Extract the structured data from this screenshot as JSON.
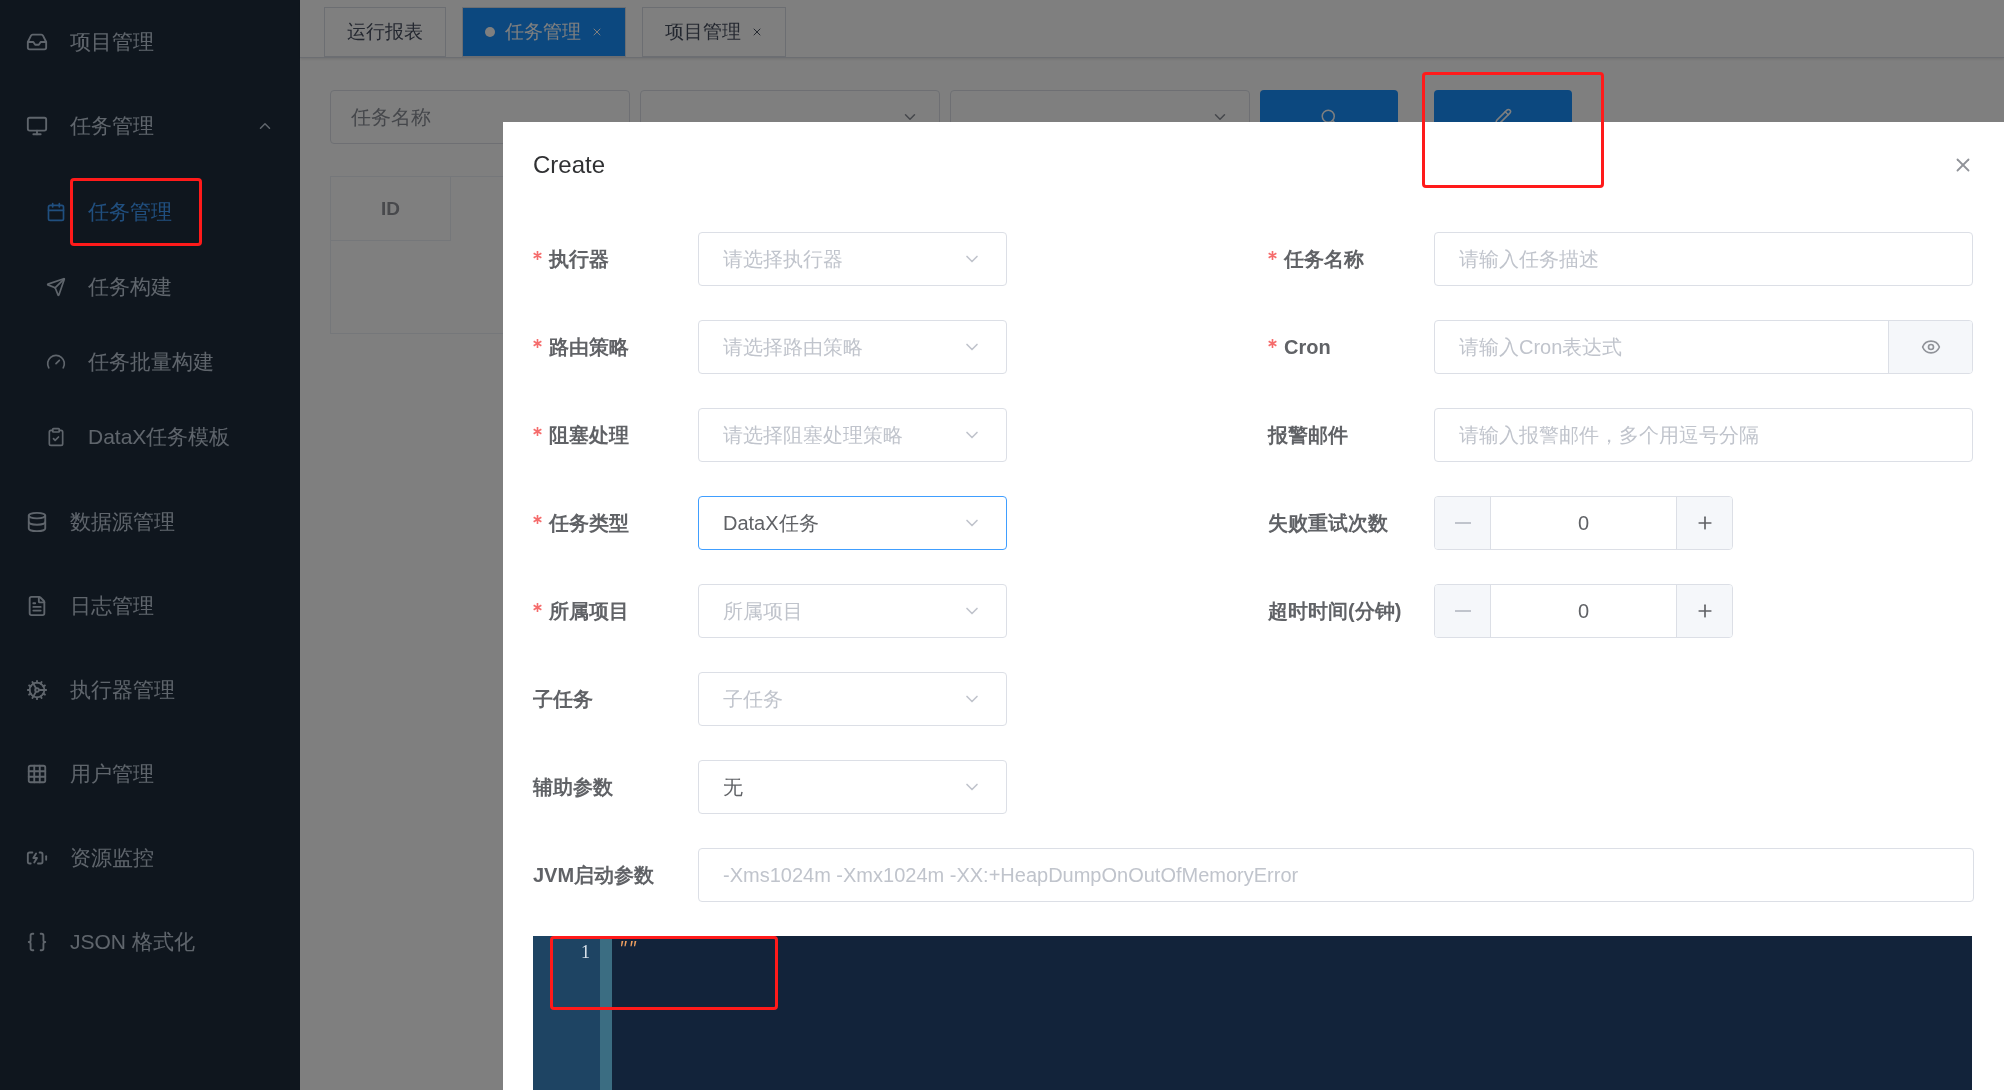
{
  "sidebar": {
    "items": [
      {
        "label": "项目管理"
      },
      {
        "label": "任务管理",
        "expanded": true,
        "children": [
          {
            "label": "任务管理",
            "selected": true,
            "highlighted": true
          },
          {
            "label": "任务构建",
            "selected": false,
            "highlighted": false
          },
          {
            "label": "任务批量构建",
            "selected": false,
            "highlighted": false
          },
          {
            "label": "DataX任务模板",
            "selected": false,
            "highlighted": false
          }
        ]
      },
      {
        "label": "数据源管理"
      },
      {
        "label": "日志管理"
      },
      {
        "label": "执行器管理"
      },
      {
        "label": "用户管理"
      },
      {
        "label": "资源监控"
      },
      {
        "label": "JSON 格式化"
      }
    ]
  },
  "tabs": [
    {
      "label": "运行报表",
      "selected": false,
      "closable": false
    },
    {
      "label": "任务管理",
      "selected": true,
      "closable": true
    },
    {
      "label": "项目管理",
      "selected": false,
      "closable": true
    }
  ],
  "toolbar": {
    "filters": [
      {
        "kind": "input",
        "placeholder": "任务名称"
      },
      {
        "kind": "select"
      },
      {
        "kind": "select"
      }
    ],
    "buttons": [
      {
        "kind": "search",
        "highlighted": false
      },
      {
        "kind": "add",
        "highlighted": true
      }
    ]
  },
  "table": {
    "columns": [
      "ID"
    ]
  },
  "modal": {
    "title": "Create",
    "left_fields": [
      {
        "label": "执行器",
        "required": true,
        "placeholder": "请选择执行器",
        "focused": false
      },
      {
        "label": "路由策略",
        "required": true,
        "placeholder": "请选择路由策略",
        "focused": false
      },
      {
        "label": "阻塞处理",
        "required": true,
        "placeholder": "请选择阻塞处理策略",
        "focused": false
      },
      {
        "label": "任务类型",
        "required": true,
        "value": "DataX任务",
        "focused": true
      },
      {
        "label": "所属项目",
        "required": true,
        "placeholder": "所属项目",
        "focused": false
      },
      {
        "label": "子任务",
        "required": false,
        "placeholder": "子任务",
        "focused": false
      },
      {
        "label": "辅助参数",
        "required": false,
        "value": "无",
        "focused": false
      }
    ],
    "right_fields": [
      {
        "kind": "input",
        "label": "任务名称",
        "required": true,
        "placeholder": "请输入任务描述"
      },
      {
        "kind": "cron",
        "label": "Cron",
        "required": true,
        "placeholder": "请输入Cron表达式"
      },
      {
        "kind": "input",
        "label": "报警邮件",
        "required": false,
        "placeholder": "请输入报警邮件，多个用逗号分隔"
      },
      {
        "kind": "number",
        "label": "失败重试次数",
        "required": false,
        "value": "0"
      },
      {
        "kind": "number",
        "label": "超时时间(分钟)",
        "required": false,
        "value": "0"
      }
    ],
    "jvm": {
      "label": "JVM启动参数",
      "placeholder": "-Xms1024m -Xmx1024m -XX:+HeapDumpOnOutOfMemoryError"
    },
    "editor": {
      "lines": [
        {
          "number": "1",
          "text": "\"\"",
          "highlighted": true
        }
      ]
    }
  }
}
